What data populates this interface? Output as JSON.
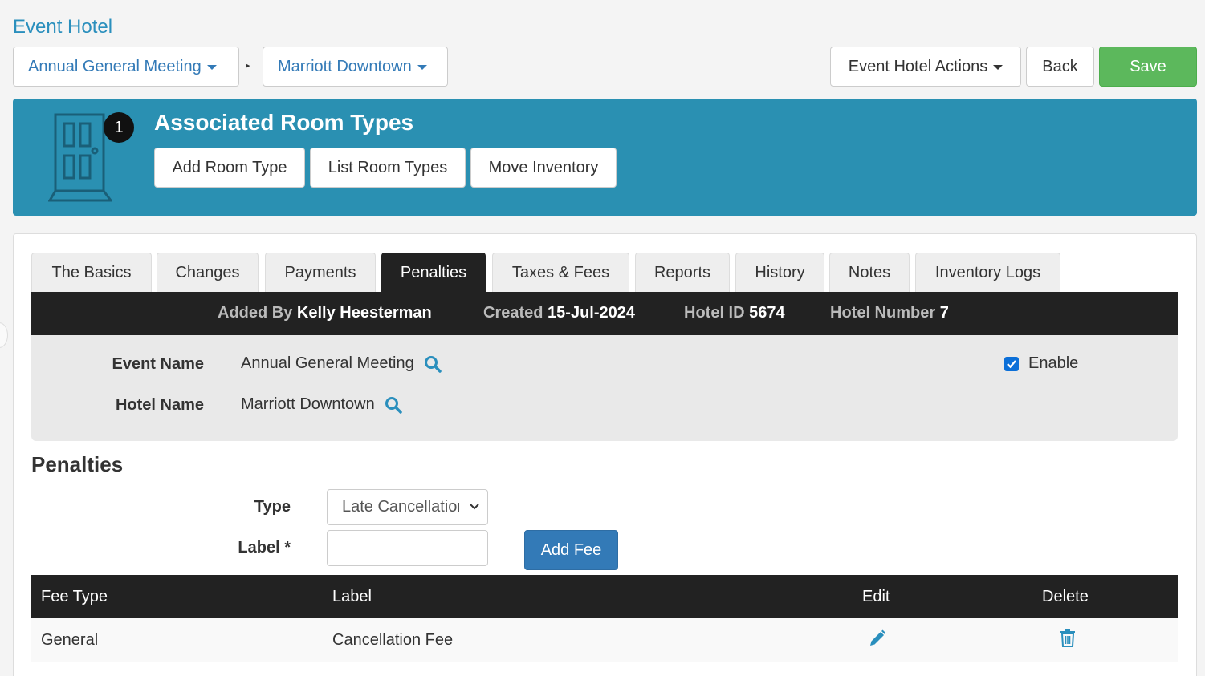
{
  "page": {
    "title": "Event Hotel"
  },
  "breadcrumb": {
    "event": "Annual General Meeting",
    "separator": "▸",
    "hotel": "Marriott Downtown"
  },
  "actions": {
    "menu_label": "Event Hotel Actions",
    "back_label": "Back",
    "save_label": "Save",
    "save_color": "#5cb85c"
  },
  "banner": {
    "badge_count": "1",
    "title": "Associated Room Types",
    "buttons": [
      "Add Room Type",
      "List Room Types",
      "Move Inventory"
    ],
    "color": "#2a90b2",
    "icon": "door-icon"
  },
  "tabs": [
    "The Basics",
    "Changes",
    "Payments",
    "Penalties",
    "Taxes & Fees",
    "Reports",
    "History",
    "Notes",
    "Inventory Logs"
  ],
  "active_tab": "Penalties",
  "info": {
    "added_by_label": "Added By",
    "added_by_value": "Kelly Heesterman",
    "created_label": "Created",
    "created_value": "15-Jul-2024",
    "hotel_id_label": "Hotel ID",
    "hotel_id_value": "5674",
    "hotel_number_label": "Hotel Number",
    "hotel_number_value": "7"
  },
  "details": {
    "event_name_label": "Event Name",
    "event_name_value": "Annual General Meeting",
    "hotel_name_label": "Hotel Name",
    "hotel_name_value": "Marriott Downtown",
    "enable_label": "Enable",
    "enable_checked": true
  },
  "penalties": {
    "title": "Penalties",
    "type_label": "Type",
    "type_value": "Late Cancellation",
    "label_label": "Label *",
    "label_value": "",
    "add_button": "Add Fee"
  },
  "table": {
    "headers": [
      "Fee Type",
      "Label",
      "Edit",
      "Delete"
    ],
    "rows": [
      {
        "fee_type": "General",
        "label": "Cancellation Fee",
        "edit_icon": "pencil-icon",
        "delete_icon": "trash-icon"
      }
    ]
  }
}
